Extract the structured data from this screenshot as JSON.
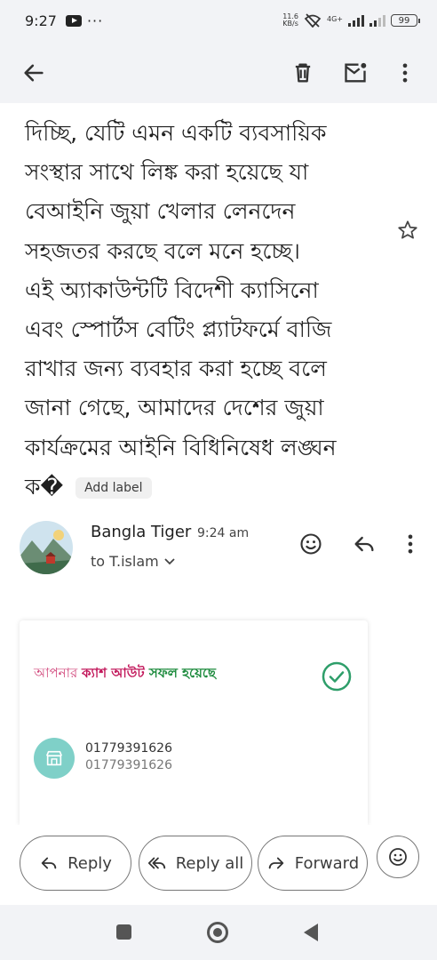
{
  "status_bar": {
    "time": "9:27",
    "dots": "···",
    "net_speed_value": "11.6",
    "net_speed_unit": "KB/s",
    "network": "4G+",
    "battery": "99"
  },
  "email": {
    "body_lines": [
      "দিচ্ছি, যেটি এমন একটি ব্যবসায়িক",
      "সংস্থার সাথে লিঙ্ক করা হয়েছে যা",
      "বেআইনি জুয়া খেলার লেনদেন",
      "সহজতর করছে বলে মনে হচ্ছে।",
      "এই অ্যাকাউন্টটি বিদেশী ক্যাসিনো",
      "এবং স্পোর্টস বেটিং প্ল্যাটফর্মে বাজি",
      "রাখার জন্য ব্যবহার করা হচ্ছে বলে",
      "জানা গেছে, আমাদের দেশের জুয়া",
      "কার্যক্রমের আইনি বিধিনিষেধ লঙ্ঘন"
    ],
    "last_line": "ক�",
    "add_label": "Add label"
  },
  "sender": {
    "name": "Bangla Tiger",
    "time": "9:24 am",
    "to": "to T.islam"
  },
  "card": {
    "title_part1": "আপনার ",
    "title_part2": "ক্যাশ আউট",
    "title_part3": " সফল হয়েছে",
    "number_primary": "01779391626",
    "number_secondary": "01779391626"
  },
  "actions": {
    "reply": "Reply",
    "reply_all": "Reply all",
    "forward": "Forward"
  },
  "icons": [
    "back-arrow-icon",
    "delete-icon",
    "mark-unread-icon",
    "more-vert-icon",
    "star-icon",
    "emoji-icon",
    "reply-icon",
    "check-circle-icon",
    "shop-icon",
    "reply-all-icon",
    "forward-icon"
  ],
  "colors": {
    "accent_pink": "#c2185b",
    "accent_green": "#1b8a3c",
    "check_teal": "#2e9e6a",
    "shop_bg": "#7fd0c8"
  }
}
